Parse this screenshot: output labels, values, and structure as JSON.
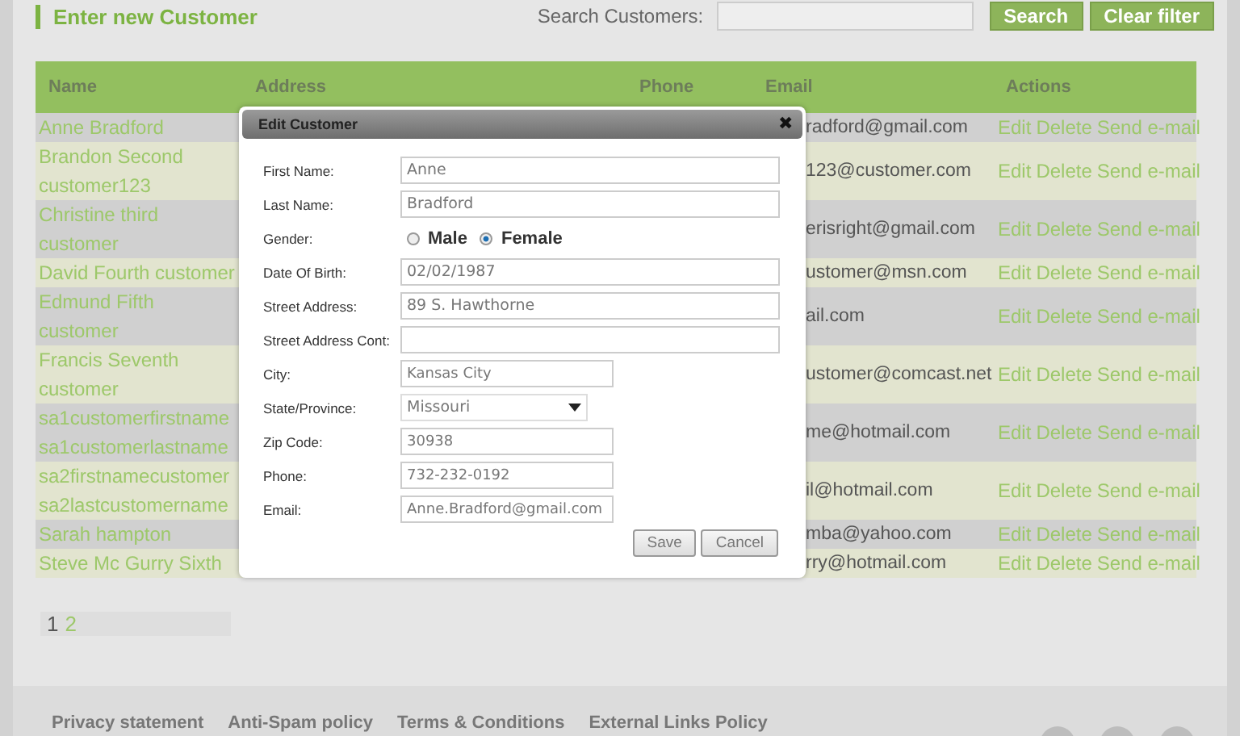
{
  "header": {
    "title": "Enter new Customer",
    "search_label": "Search Customers:",
    "buttons": [
      "Search",
      "Clear filter"
    ]
  },
  "table": {
    "columns": [
      "Name",
      "Address",
      "Phone",
      "Email",
      "Actions"
    ],
    "rows": [
      {
        "name": "Anne Bradford",
        "email": "radford@gmail.com",
        "actions": [
          "Edit",
          "Delete",
          "Send e-mail"
        ]
      },
      {
        "name": "Brandon Second customer123",
        "email": "123@customer.com",
        "actions": [
          "Edit",
          "Delete",
          "Send e-mail"
        ]
      },
      {
        "name": "Christine third customer",
        "email": "erisright@gmail.com",
        "actions": [
          "Edit",
          "Delete",
          "Send e-mail"
        ]
      },
      {
        "name": "David Fourth customer",
        "email": "ustomer@msn.com",
        "actions": [
          "Edit",
          "Delete",
          "Send e-mail"
        ]
      },
      {
        "name": "Edmund Fifth customer",
        "email": "ail.com",
        "actions": [
          "Edit",
          "Delete",
          "Send e-mail"
        ]
      },
      {
        "name": "Francis Seventh customer",
        "email": "ustomer@comcast.net",
        "actions": [
          "Edit",
          "Delete",
          "Send e-mail"
        ]
      },
      {
        "name": "sa1customerfirstname sa1customerlastname",
        "email": "me@hotmail.com",
        "actions": [
          "Edit",
          "Delete",
          "Send e-mail"
        ]
      },
      {
        "name": "sa2firstnamecustomer sa2lastcustomername",
        "email": "il@hotmail.com",
        "actions": [
          "Edit",
          "Delete",
          "Send e-mail"
        ]
      },
      {
        "name": "Sarah hampton",
        "email": "mba@yahoo.com",
        "actions": [
          "Edit",
          "Delete",
          "Send e-mail"
        ]
      },
      {
        "name": "Steve Mc Gurry Sixth",
        "email": "rry@hotmail.com",
        "actions": [
          "Edit",
          "Delete",
          "Send e-mail"
        ]
      }
    ]
  },
  "pagination": [
    {
      "label": "1",
      "selected": true
    },
    {
      "label": "2",
      "selected": false
    }
  ],
  "dialog": {
    "title": "Edit Customer",
    "close": "✖",
    "fields": [
      {
        "kind": "text",
        "label": "First Name:",
        "value": "Anne"
      },
      {
        "kind": "text",
        "label": "Last Name:",
        "value": "Bradford"
      },
      {
        "kind": "radio",
        "label": "Gender:",
        "options": [
          {
            "label": "Male",
            "selected": false
          },
          {
            "label": "Female",
            "selected": true
          }
        ]
      },
      {
        "kind": "text",
        "label": "Date Of Birth:",
        "value": "02/02/1987"
      },
      {
        "kind": "text",
        "label": "Street Address:",
        "value": "89 S. Hawthorne"
      },
      {
        "kind": "text",
        "label": "Street Address Cont:"
      },
      {
        "kind": "short",
        "label": "City:",
        "value": "Kansas City"
      },
      {
        "kind": "select",
        "label": "State/Province:",
        "value": "Missouri"
      },
      {
        "kind": "short",
        "label": "Zip Code:",
        "value": "30938"
      },
      {
        "kind": "short",
        "label": "Phone:",
        "value": "732-232-0192"
      },
      {
        "kind": "short",
        "label": "Email:",
        "value": "Anne.Bradford@gmail.com"
      }
    ],
    "buttons": [
      "Save",
      "Cancel"
    ]
  },
  "footer": {
    "links": [
      "Privacy statement",
      "Anti-Spam policy",
      "Terms & Conditions",
      "External Links Policy"
    ]
  }
}
